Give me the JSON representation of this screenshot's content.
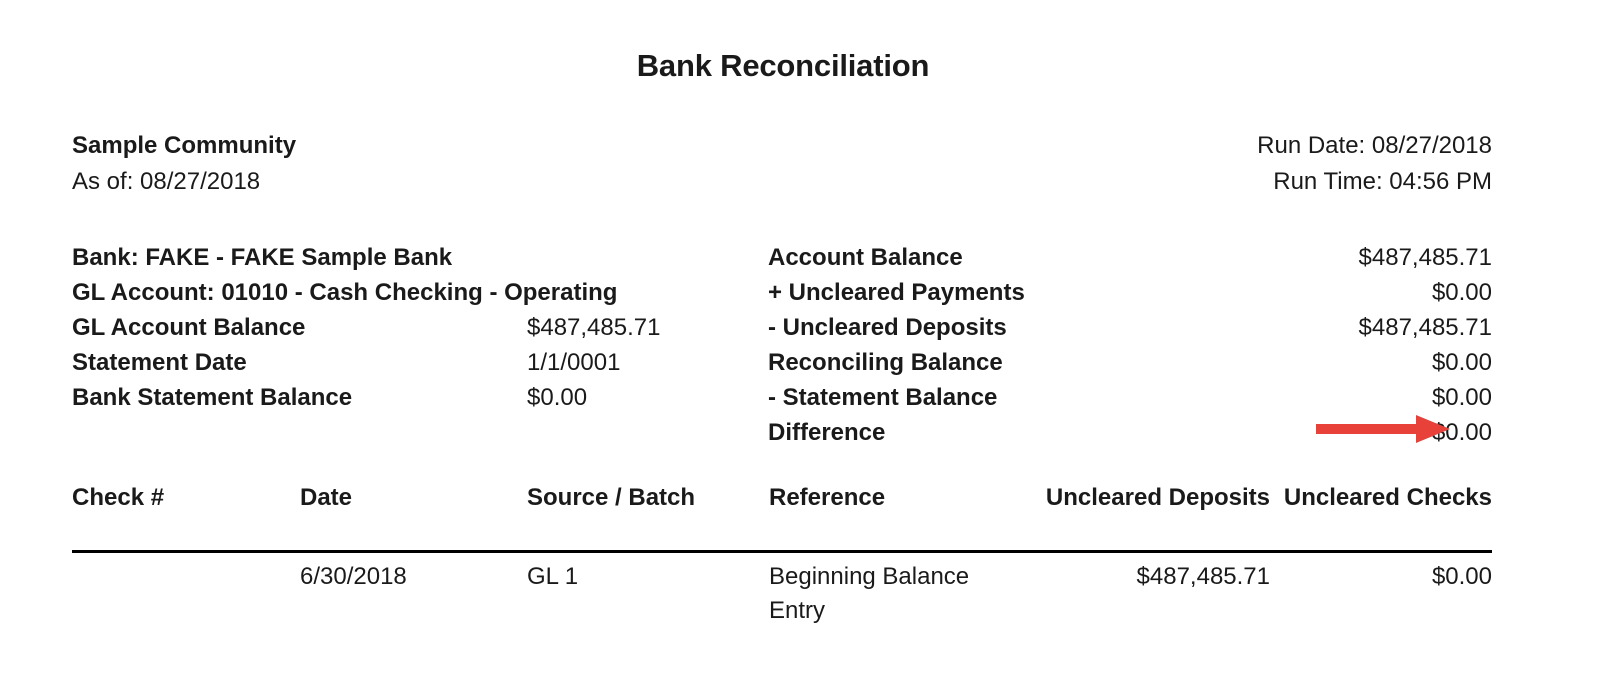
{
  "document": {
    "title": "Bank Reconciliation"
  },
  "header": {
    "organization": "Sample Community",
    "as_of": "As of: 08/27/2018",
    "run_date": "Run Date: 08/27/2018",
    "run_time": "Run Time: 04:56 PM"
  },
  "summary_left": [
    {
      "label": "Bank: FAKE - FAKE Sample Bank",
      "value": ""
    },
    {
      "label": "GL Account: 01010 - Cash Checking - Operating",
      "value": ""
    },
    {
      "label": "GL Account Balance",
      "value": "$487,485.71"
    },
    {
      "label": "Statement Date",
      "value": "1/1/0001"
    },
    {
      "label": "Bank Statement Balance",
      "value": "$0.00"
    }
  ],
  "summary_right": [
    {
      "label": "Account Balance",
      "value": "$487,485.71"
    },
    {
      "label": "+ Uncleared Payments",
      "value": "$0.00"
    },
    {
      "label": "- Uncleared Deposits",
      "value": "$487,485.71"
    },
    {
      "label": "Reconciling Balance",
      "value": "$0.00"
    },
    {
      "label": "- Statement Balance",
      "value": "$0.00"
    },
    {
      "label": "Difference",
      "value": "$0.00"
    }
  ],
  "annotation": {
    "name": "red-arrow-pointing-to-difference",
    "color": "#E8413A",
    "points_to": "Difference"
  },
  "table": {
    "columns": {
      "check": "Check #",
      "date": "Date",
      "source": "Source / Batch",
      "reference": "Reference",
      "uncleared_deposits": "Uncleared Deposits",
      "uncleared_checks": "Uncleared Checks"
    },
    "rows": [
      {
        "check": "",
        "date": "6/30/2018",
        "source": "GL 1",
        "reference": "Beginning Balance Entry",
        "uncleared_deposits": "$487,485.71",
        "uncleared_checks": "$0.00"
      }
    ]
  }
}
